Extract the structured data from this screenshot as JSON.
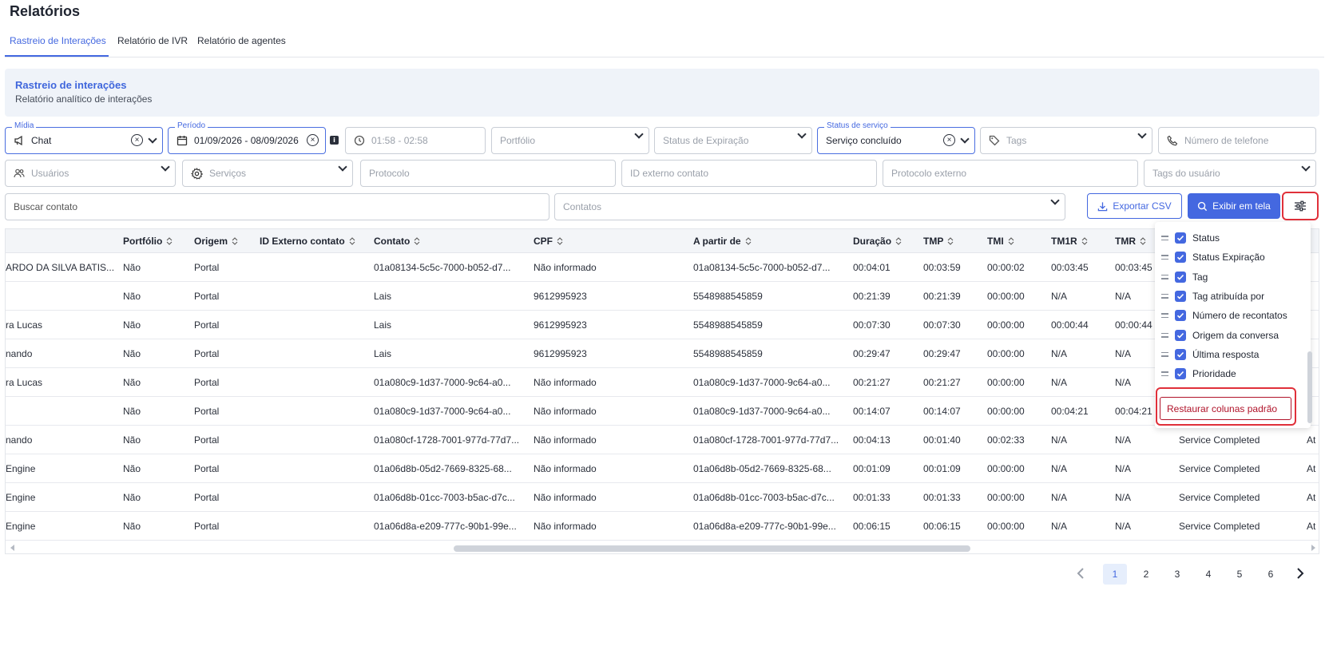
{
  "page": {
    "title": "Relatórios"
  },
  "tabs": [
    {
      "label": "Rastreio de Interações",
      "active": true
    },
    {
      "label": "Relatório de IVR",
      "active": false
    },
    {
      "label": "Relatório de agentes",
      "active": false
    }
  ],
  "banner": {
    "title": "Rastreio de interações",
    "subtitle": "Relatório analítico de interações"
  },
  "filters": {
    "midia": {
      "legend": "Mídia",
      "value": "Chat"
    },
    "periodo": {
      "legend": "Período",
      "value": "01/09/2026 - 08/09/2026"
    },
    "time": {
      "placeholder": "01:58 - 02:58"
    },
    "portfolio": {
      "placeholder": "Portfólio"
    },
    "status_expiracao": {
      "placeholder": "Status de Expiração"
    },
    "status_servico": {
      "legend": "Status de serviço",
      "value": "Serviço concluído"
    },
    "tags": {
      "placeholder": "Tags"
    },
    "telefone": {
      "placeholder": "Número de telefone"
    },
    "usuarios": {
      "placeholder": "Usuários"
    },
    "servicos": {
      "placeholder": "Serviços"
    },
    "protocolo": {
      "placeholder": "Protocolo"
    },
    "id_externo": {
      "placeholder": "ID externo contato"
    },
    "protocolo_externo": {
      "placeholder": "Protocolo externo"
    },
    "tags_usuario": {
      "placeholder": "Tags do usuário"
    },
    "buscar": {
      "placeholder": "Buscar contato"
    },
    "contatos": {
      "placeholder": "Contatos"
    }
  },
  "actions": {
    "export": "Exportar CSV",
    "show": "Exibir em tela"
  },
  "table": {
    "headers": [
      "Portfólio",
      "Origem",
      "ID Externo contato",
      "Contato",
      "CPF",
      "A partir de",
      "Duração",
      "TMP",
      "TMI",
      "TM1R",
      "TMR"
    ],
    "rows": [
      [
        "ARDO DA SILVA BATIS...",
        "Não",
        "Portal",
        "",
        "01a08134-5c5c-7000-b052-d7...",
        "Não informado",
        "01a08134-5c5c-7000-b052-d7...",
        "00:04:01",
        "00:03:59",
        "00:00:02",
        "00:03:45",
        "00:03:45",
        "",
        ""
      ],
      [
        "",
        "Não",
        "Portal",
        "",
        "Lais",
        "9612995923",
        "5548988545859",
        "00:21:39",
        "00:21:39",
        "00:00:00",
        "N/A",
        "N/A",
        "",
        ""
      ],
      [
        "ra Lucas",
        "Não",
        "Portal",
        "",
        "Lais",
        "9612995923",
        "5548988545859",
        "00:07:30",
        "00:07:30",
        "00:00:00",
        "00:00:44",
        "00:00:44",
        "",
        ""
      ],
      [
        "nando",
        "Não",
        "Portal",
        "",
        "Lais",
        "9612995923",
        "5548988545859",
        "00:29:47",
        "00:29:47",
        "00:00:00",
        "N/A",
        "N/A",
        "",
        ""
      ],
      [
        "ra Lucas",
        "Não",
        "Portal",
        "",
        "01a080c9-1d37-7000-9c64-a0...",
        "Não informado",
        "01a080c9-1d37-7000-9c64-a0...",
        "00:21:27",
        "00:21:27",
        "00:00:00",
        "N/A",
        "N/A",
        "",
        ""
      ],
      [
        "",
        "Não",
        "Portal",
        "",
        "01a080c9-1d37-7000-9c64-a0...",
        "Não informado",
        "01a080c9-1d37-7000-9c64-a0...",
        "00:14:07",
        "00:14:07",
        "00:00:00",
        "00:04:21",
        "00:04:21",
        "",
        ""
      ],
      [
        "nando",
        "Não",
        "Portal",
        "",
        "01a080cf-1728-7001-977d-77d7...",
        "Não informado",
        "01a080cf-1728-7001-977d-77d7...",
        "00:04:13",
        "00:01:40",
        "00:02:33",
        "N/A",
        "N/A",
        "Service Completed",
        "At"
      ],
      [
        " Engine",
        "Não",
        "Portal",
        "",
        "01a06d8b-05d2-7669-8325-68...",
        "Não informado",
        "01a06d8b-05d2-7669-8325-68...",
        "00:01:09",
        "00:01:09",
        "00:00:00",
        "N/A",
        "N/A",
        "Service Completed",
        "At"
      ],
      [
        " Engine",
        "Não",
        "Portal",
        "",
        "01a06d8b-01cc-7003-b5ac-d7c...",
        "Não informado",
        "01a06d8b-01cc-7003-b5ac-d7c...",
        "00:01:33",
        "00:01:33",
        "00:00:00",
        "N/A",
        "N/A",
        "Service Completed",
        "At"
      ],
      [
        " Engine",
        "Não",
        "Portal",
        "",
        "01a06d8a-e209-777c-90b1-99e...",
        "Não informado",
        "01a06d8a-e209-777c-90b1-99e...",
        "00:06:15",
        "00:06:15",
        "00:00:00",
        "N/A",
        "N/A",
        "Service Completed",
        "At"
      ]
    ]
  },
  "column_panel": {
    "items": [
      "Status",
      "Status Expiração",
      "Tag",
      "Tag atribuída por",
      "Número de recontatos",
      "Origem da conversa",
      "Última resposta",
      "Prioridade"
    ],
    "restore": "Restaurar colunas padrão"
  },
  "pagination": {
    "pages": [
      "1",
      "2",
      "3",
      "4",
      "5",
      "6"
    ],
    "current": "1"
  },
  "colors": {
    "accent": "#4468e0",
    "highlight_red": "#e0303a",
    "restore_text": "#b0132a"
  }
}
